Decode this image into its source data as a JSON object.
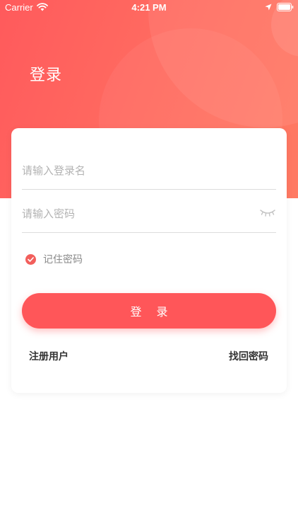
{
  "status_bar": {
    "carrier": "Carrier",
    "time": "4:21 PM"
  },
  "header": {
    "title": "登录"
  },
  "form": {
    "username_placeholder": "请输入登录名",
    "username_value": "",
    "password_placeholder": "请输入密码",
    "password_value": "",
    "remember_label": "记住密码",
    "remember_checked": true,
    "login_label": "登 录",
    "register_label": "注册用户",
    "forgot_label": "找回密码"
  },
  "colors": {
    "accent": "#ff5659",
    "header_gradient_start": "#ff5a5c",
    "header_gradient_end": "#ff7a63",
    "placeholder": "#b3b3b3"
  },
  "icons": {
    "status": [
      "wifi-icon",
      "location-icon",
      "battery-icon"
    ],
    "password_toggle": "eye-closed-icon",
    "remember": "check-icon"
  }
}
